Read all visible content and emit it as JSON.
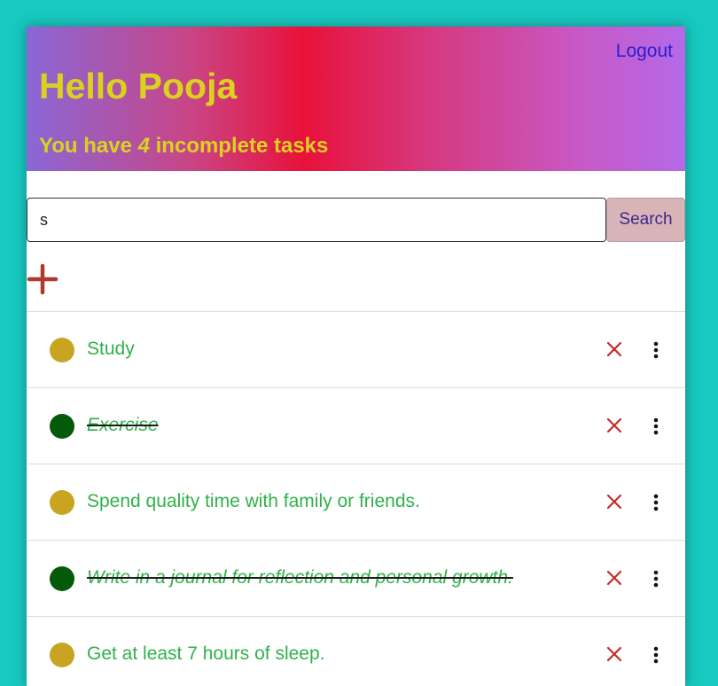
{
  "header": {
    "logout_label": "Logout",
    "greeting": "Hello Pooja",
    "summary_prefix": "You have ",
    "incomplete_count": "4",
    "summary_suffix": " incomplete tasks"
  },
  "search": {
    "value": "s",
    "button_label": "Search"
  },
  "tasks": [
    {
      "text": "Study",
      "completed": false
    },
    {
      "text": "Exercise",
      "completed": true
    },
    {
      "text": "Spend quality time with family or friends.",
      "completed": false
    },
    {
      "text": "Write in a journal for reflection and personal growth.",
      "completed": true
    },
    {
      "text": "Get at least 7 hours of sleep.",
      "completed": false
    }
  ],
  "colors": {
    "page_background": "#17c9c0",
    "header_text": "#dbd220",
    "logout": "#2b1ecf",
    "task_text": "#2fb24a",
    "incomplete_dot": "#c9a421",
    "complete_dot": "#045a08",
    "delete_icon": "#c42b2b",
    "add_icon": "#b03a2e"
  }
}
